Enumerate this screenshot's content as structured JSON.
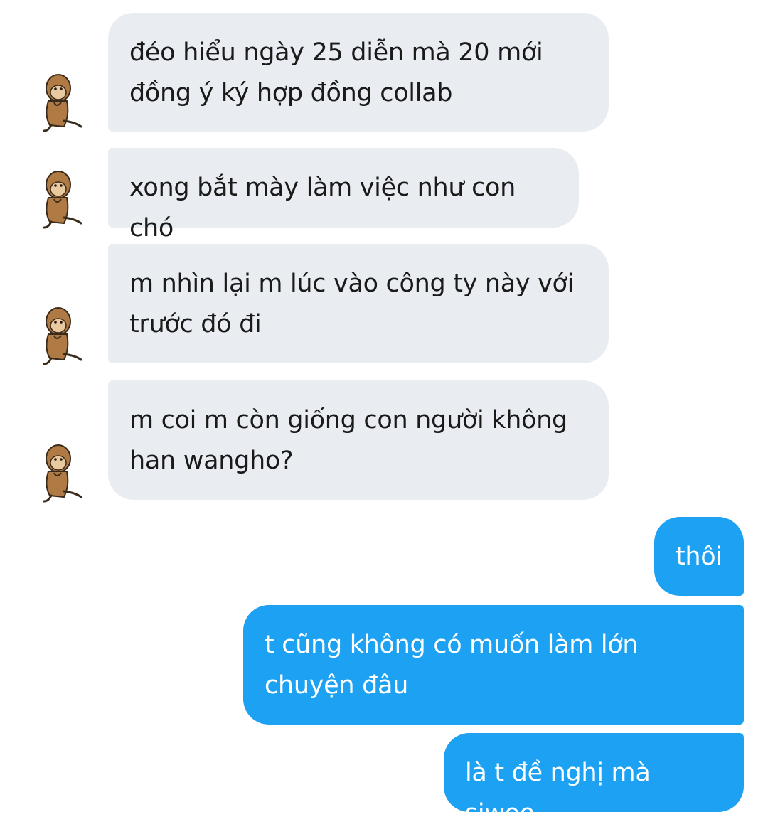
{
  "conversation": {
    "messages": [
      {
        "sender": "other",
        "text": "đéo hiểu ngày 25 diễn mà 20 mới\nđồng ý ký hợp đồng collab"
      },
      {
        "sender": "other",
        "text": "xong bắt mày làm việc như con chó"
      },
      {
        "sender": "other",
        "text": "m nhìn lại m lúc vào công ty này với\ntrước đó đi"
      },
      {
        "sender": "other",
        "text": "m coi m còn giống con người không\nhan wangho?"
      },
      {
        "sender": "self",
        "text": "thôi"
      },
      {
        "sender": "self",
        "text": "t cũng không có muốn làm lớn\nchuyện đâu"
      },
      {
        "sender": "self",
        "text": "là t đề nghị mà siwoo"
      }
    ]
  },
  "avatar": {
    "icon": "monkey-sticker-icon"
  },
  "colors": {
    "incoming_bubble": "#e9edf1",
    "outgoing_bubble": "#1da1f2",
    "incoming_text": "#1a1a1a",
    "outgoing_text": "#ffffff",
    "avatar_fur": "#b07a45"
  }
}
